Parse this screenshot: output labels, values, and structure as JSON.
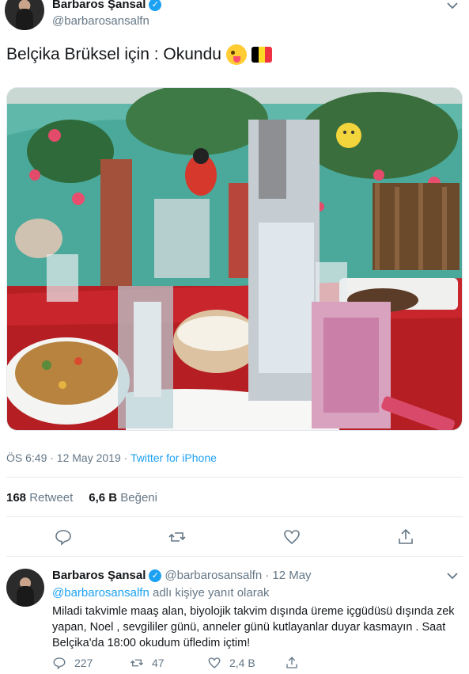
{
  "tweet": {
    "author_name": "Barbaros Şansal",
    "author_handle": "@barbarosansalfn",
    "text": "Belçika Brüksel için : Okundu",
    "emoji": [
      "winking-face-tongue-emoji",
      "belgium-flag-emoji"
    ],
    "timestamp": "ÖS 6:49 · 12 May 2019 · ",
    "source": "Twitter for iPhone",
    "retweet_count": "168",
    "retweet_label": "Retweet",
    "like_count": "6,6 B",
    "like_label": "Beğeni",
    "actions": [
      "reply-icon",
      "retweet-icon",
      "like-icon",
      "share-icon"
    ]
  },
  "reply": {
    "author_name": "Barbaros Şansal",
    "author_handle": "@barbarosansalfn",
    "date": "· 12 May",
    "reply_to_mention": "@barbarosansalfn",
    "reply_to_suffix": " adlı kişiye yanıt olarak",
    "text": "Miladi takvimle maaş alan, biyolojik takvim dışında üreme içgüdüsü dışında zek yapan, Noel , sevgililer günü, anneler günü kutlayanlar duyar kasmayın . Saat Belçika'da 18:00 okudum üfledim içtim!",
    "reply_count": "227",
    "retweet_count": "47",
    "like_count": "2,4 B"
  },
  "colors": {
    "accent": "#1da1f2",
    "secondary_text": "#657786",
    "flag_black": "#000000",
    "flag_yellow": "#fdda24",
    "flag_red": "#ef3340"
  }
}
